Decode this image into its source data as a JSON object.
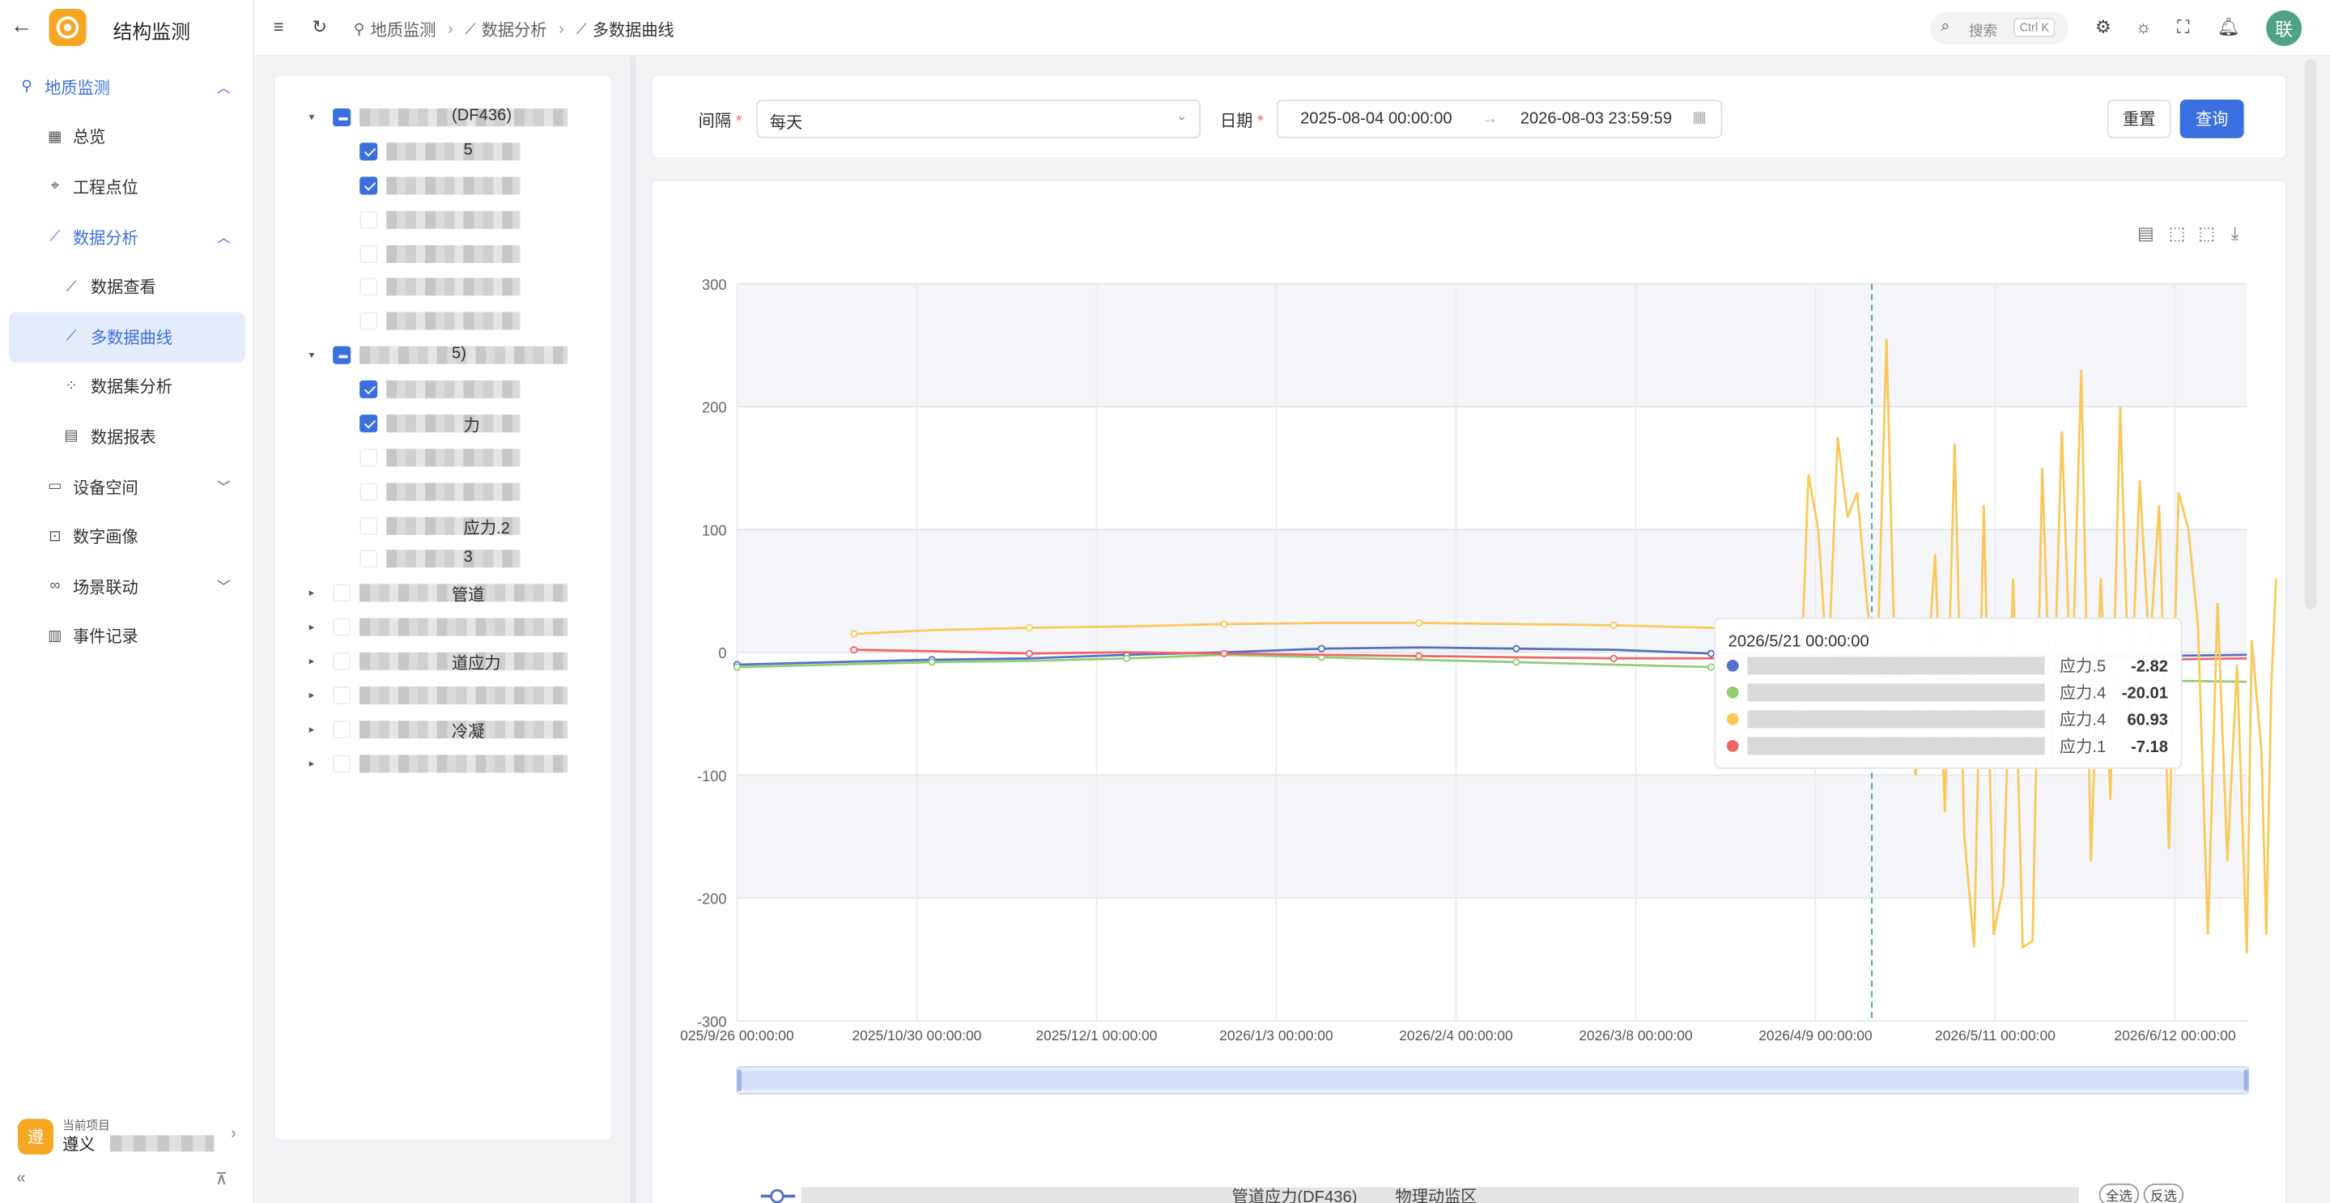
{
  "app": {
    "title": "结构监测",
    "logo": "logo-icon"
  },
  "sidebar": {
    "items": [
      {
        "label": "地质监测",
        "icon": "location-icon",
        "level": 0,
        "expanded": true
      },
      {
        "label": "总览",
        "icon": "grid-icon",
        "level": 1
      },
      {
        "label": "工程点位",
        "icon": "pin-icon",
        "level": 1
      },
      {
        "label": "数据分析",
        "icon": "chart-icon",
        "level": 1,
        "expanded": true
      },
      {
        "label": "数据查看",
        "icon": "trend-icon",
        "level": 2
      },
      {
        "label": "多数据曲线",
        "icon": "trend-icon",
        "level": 2,
        "active": true
      },
      {
        "label": "数据集分析",
        "icon": "scatter-icon",
        "level": 2
      },
      {
        "label": "数据报表",
        "icon": "report-icon",
        "level": 2
      },
      {
        "label": "设备空间",
        "icon": "device-icon",
        "level": 1,
        "expanded": false
      },
      {
        "label": "数字画像",
        "icon": "scan-icon",
        "level": 1
      },
      {
        "label": "场景联动",
        "icon": "link-icon",
        "level": 1,
        "expanded": false
      },
      {
        "label": "事件记录",
        "icon": "log-icon",
        "level": 1
      }
    ],
    "project": {
      "caption": "当前项目",
      "badge": "遵",
      "name": "遵义"
    }
  },
  "header": {
    "breadcrumb": [
      "地质监测",
      "数据分析",
      "多数据曲线"
    ],
    "search": {
      "placeholder": "搜索",
      "shortcut": "Ctrl K"
    },
    "avatar": "联"
  },
  "tree": {
    "nodes": [
      {
        "y": 77,
        "indent": 0,
        "tri": "▾",
        "check": "half",
        "suffix": "(DF436)"
      },
      {
        "y": 100,
        "indent": 1,
        "check": "on",
        "suffix": "5"
      },
      {
        "y": 123,
        "indent": 1,
        "check": "on",
        "suffix": ""
      },
      {
        "y": 146,
        "indent": 1,
        "check": "off",
        "suffix": ""
      },
      {
        "y": 169,
        "indent": 1,
        "check": "off",
        "suffix": ""
      },
      {
        "y": 191,
        "indent": 1,
        "check": "off",
        "suffix": ""
      },
      {
        "y": 214,
        "indent": 1,
        "check": "off",
        "suffix": ""
      },
      {
        "y": 237,
        "indent": 0,
        "tri": "▾",
        "check": "half",
        "suffix": "5)"
      },
      {
        "y": 260,
        "indent": 1,
        "check": "on",
        "suffix": ""
      },
      {
        "y": 283,
        "indent": 1,
        "check": "on",
        "suffix": "力"
      },
      {
        "y": 306,
        "indent": 1,
        "check": "off",
        "suffix": ""
      },
      {
        "y": 329,
        "indent": 1,
        "check": "off",
        "suffix": ""
      },
      {
        "y": 352,
        "indent": 1,
        "check": "off",
        "suffix": "应力.2"
      },
      {
        "y": 374,
        "indent": 1,
        "check": "off",
        "suffix": "3"
      },
      {
        "y": 397,
        "indent": 0,
        "tri": "▸",
        "check": "off",
        "suffix": "管道"
      },
      {
        "y": 420,
        "indent": 0,
        "tri": "▸",
        "check": "off",
        "suffix": ""
      },
      {
        "y": 443,
        "indent": 0,
        "tri": "▸",
        "check": "off",
        "suffix": "道应力"
      },
      {
        "y": 466,
        "indent": 0,
        "tri": "▸",
        "check": "off",
        "suffix": ""
      },
      {
        "y": 489,
        "indent": 0,
        "tri": "▸",
        "check": "off",
        "suffix": "冷凝"
      },
      {
        "y": 512,
        "indent": 0,
        "tri": "▸",
        "check": "off",
        "suffix": ""
      }
    ]
  },
  "filter": {
    "interval_label": "间隔",
    "interval_value": "每天",
    "date_label": "日期",
    "date_start": "2025-08-04 00:00:00",
    "date_end": "2026-08-03 23:59:59",
    "reset_label": "重置",
    "query_label": "查询"
  },
  "toolbox": [
    "data-view-icon",
    "zoom-icon",
    "zoom-reset-icon",
    "download-icon"
  ],
  "tooltip": {
    "title": "2026/5/21 00:00:00",
    "rows": [
      {
        "color": "#5470c6",
        "name": "应力.5",
        "value": "-2.82"
      },
      {
        "color": "#91cc75",
        "name": "应力.4",
        "value": "-20.01"
      },
      {
        "color": "#fac858",
        "name": "应力.4",
        "value": "60.93"
      },
      {
        "color": "#ee6666",
        "name": "应力.1",
        "value": "-7.18"
      }
    ]
  },
  "legend": {
    "text": "管道应力(DF436)",
    "suffix": "物理动监区",
    "select_all": "全选",
    "invert": "反选"
  },
  "chart_data": {
    "type": "line",
    "ylim": [
      -300,
      300
    ],
    "yticks": [
      300,
      200,
      100,
      0,
      -100,
      -200,
      -300
    ],
    "xtick_labels": [
      "025/9/26 00:00:00",
      "2025/10/30 00:00:00",
      "2025/12/1 00:00:00",
      "2026/1/3 00:00:00",
      "2026/2/4 00:00:00",
      "2026/3/8 00:00:00",
      "2026/4/9 00:00:00",
      "2026/5/11 00:00:00",
      "2026/6/12 00:00:00"
    ],
    "x_range_days": [
      0,
      310
    ],
    "cursor_day": 233,
    "series": [
      {
        "color": "#5470c6",
        "points": [
          [
            0,
            -10
          ],
          [
            20,
            -8
          ],
          [
            40,
            -6
          ],
          [
            60,
            -5
          ],
          [
            80,
            -2
          ],
          [
            100,
            0
          ],
          [
            120,
            3
          ],
          [
            140,
            4
          ],
          [
            160,
            3
          ],
          [
            180,
            2
          ],
          [
            200,
            -1
          ],
          [
            220,
            -2
          ],
          [
            233,
            -3
          ],
          [
            260,
            -3
          ],
          [
            290,
            -3
          ],
          [
            310,
            -2
          ]
        ]
      },
      {
        "color": "#91cc75",
        "points": [
          [
            0,
            -12
          ],
          [
            20,
            -10
          ],
          [
            40,
            -8
          ],
          [
            60,
            -7
          ],
          [
            80,
            -5
          ],
          [
            100,
            -2
          ],
          [
            120,
            -4
          ],
          [
            140,
            -6
          ],
          [
            160,
            -8
          ],
          [
            180,
            -10
          ],
          [
            200,
            -12
          ],
          [
            220,
            -15
          ],
          [
            233,
            -20
          ],
          [
            260,
            -22
          ],
          [
            290,
            -23
          ],
          [
            310,
            -24
          ]
        ]
      },
      {
        "color": "#ee6666",
        "points": [
          [
            24,
            2
          ],
          [
            40,
            1
          ],
          [
            60,
            -1
          ],
          [
            80,
            0
          ],
          [
            100,
            -1
          ],
          [
            120,
            -2
          ],
          [
            140,
            -3
          ],
          [
            160,
            -4
          ],
          [
            180,
            -5
          ],
          [
            200,
            -5
          ],
          [
            220,
            -6
          ],
          [
            233,
            -7
          ],
          [
            260,
            -7
          ],
          [
            290,
            -6
          ],
          [
            310,
            -5
          ]
        ]
      },
      {
        "color": "#fac858",
        "points": [
          [
            24,
            15
          ],
          [
            40,
            18
          ],
          [
            60,
            20
          ],
          [
            80,
            21
          ],
          [
            100,
            23
          ],
          [
            120,
            24
          ],
          [
            140,
            24
          ],
          [
            160,
            23
          ],
          [
            180,
            22
          ],
          [
            200,
            20
          ],
          [
            214,
            18
          ],
          [
            218,
            -70
          ],
          [
            220,
            145
          ],
          [
            222,
            100
          ],
          [
            224,
            -20
          ],
          [
            226,
            175
          ],
          [
            228,
            110
          ],
          [
            230,
            130
          ],
          [
            232,
            40
          ],
          [
            234,
            -30
          ],
          [
            236,
            255
          ],
          [
            238,
            -50
          ],
          [
            240,
            -10
          ],
          [
            242,
            -100
          ],
          [
            244,
            -40
          ],
          [
            246,
            80
          ],
          [
            248,
            -130
          ],
          [
            250,
            170
          ],
          [
            252,
            -150
          ],
          [
            254,
            -240
          ],
          [
            256,
            120
          ],
          [
            258,
            -230
          ],
          [
            260,
            -190
          ],
          [
            262,
            60
          ],
          [
            264,
            -240
          ],
          [
            266,
            -235
          ],
          [
            268,
            150
          ],
          [
            270,
            -90
          ],
          [
            272,
            180
          ],
          [
            274,
            -40
          ],
          [
            276,
            230
          ],
          [
            278,
            -170
          ],
          [
            280,
            60
          ],
          [
            282,
            -120
          ],
          [
            284,
            200
          ],
          [
            286,
            -60
          ],
          [
            288,
            140
          ],
          [
            290,
            0
          ],
          [
            292,
            120
          ],
          [
            294,
            -160
          ],
          [
            296,
            130
          ],
          [
            298,
            100
          ],
          [
            300,
            20
          ],
          [
            302,
            -230
          ],
          [
            304,
            40
          ],
          [
            306,
            -170
          ],
          [
            308,
            -10
          ],
          [
            310,
            -245
          ],
          [
            311,
            10
          ],
          [
            313,
            -80
          ],
          [
            314,
            -230
          ],
          [
            315,
            -30
          ],
          [
            316,
            60
          ]
        ]
      }
    ]
  }
}
